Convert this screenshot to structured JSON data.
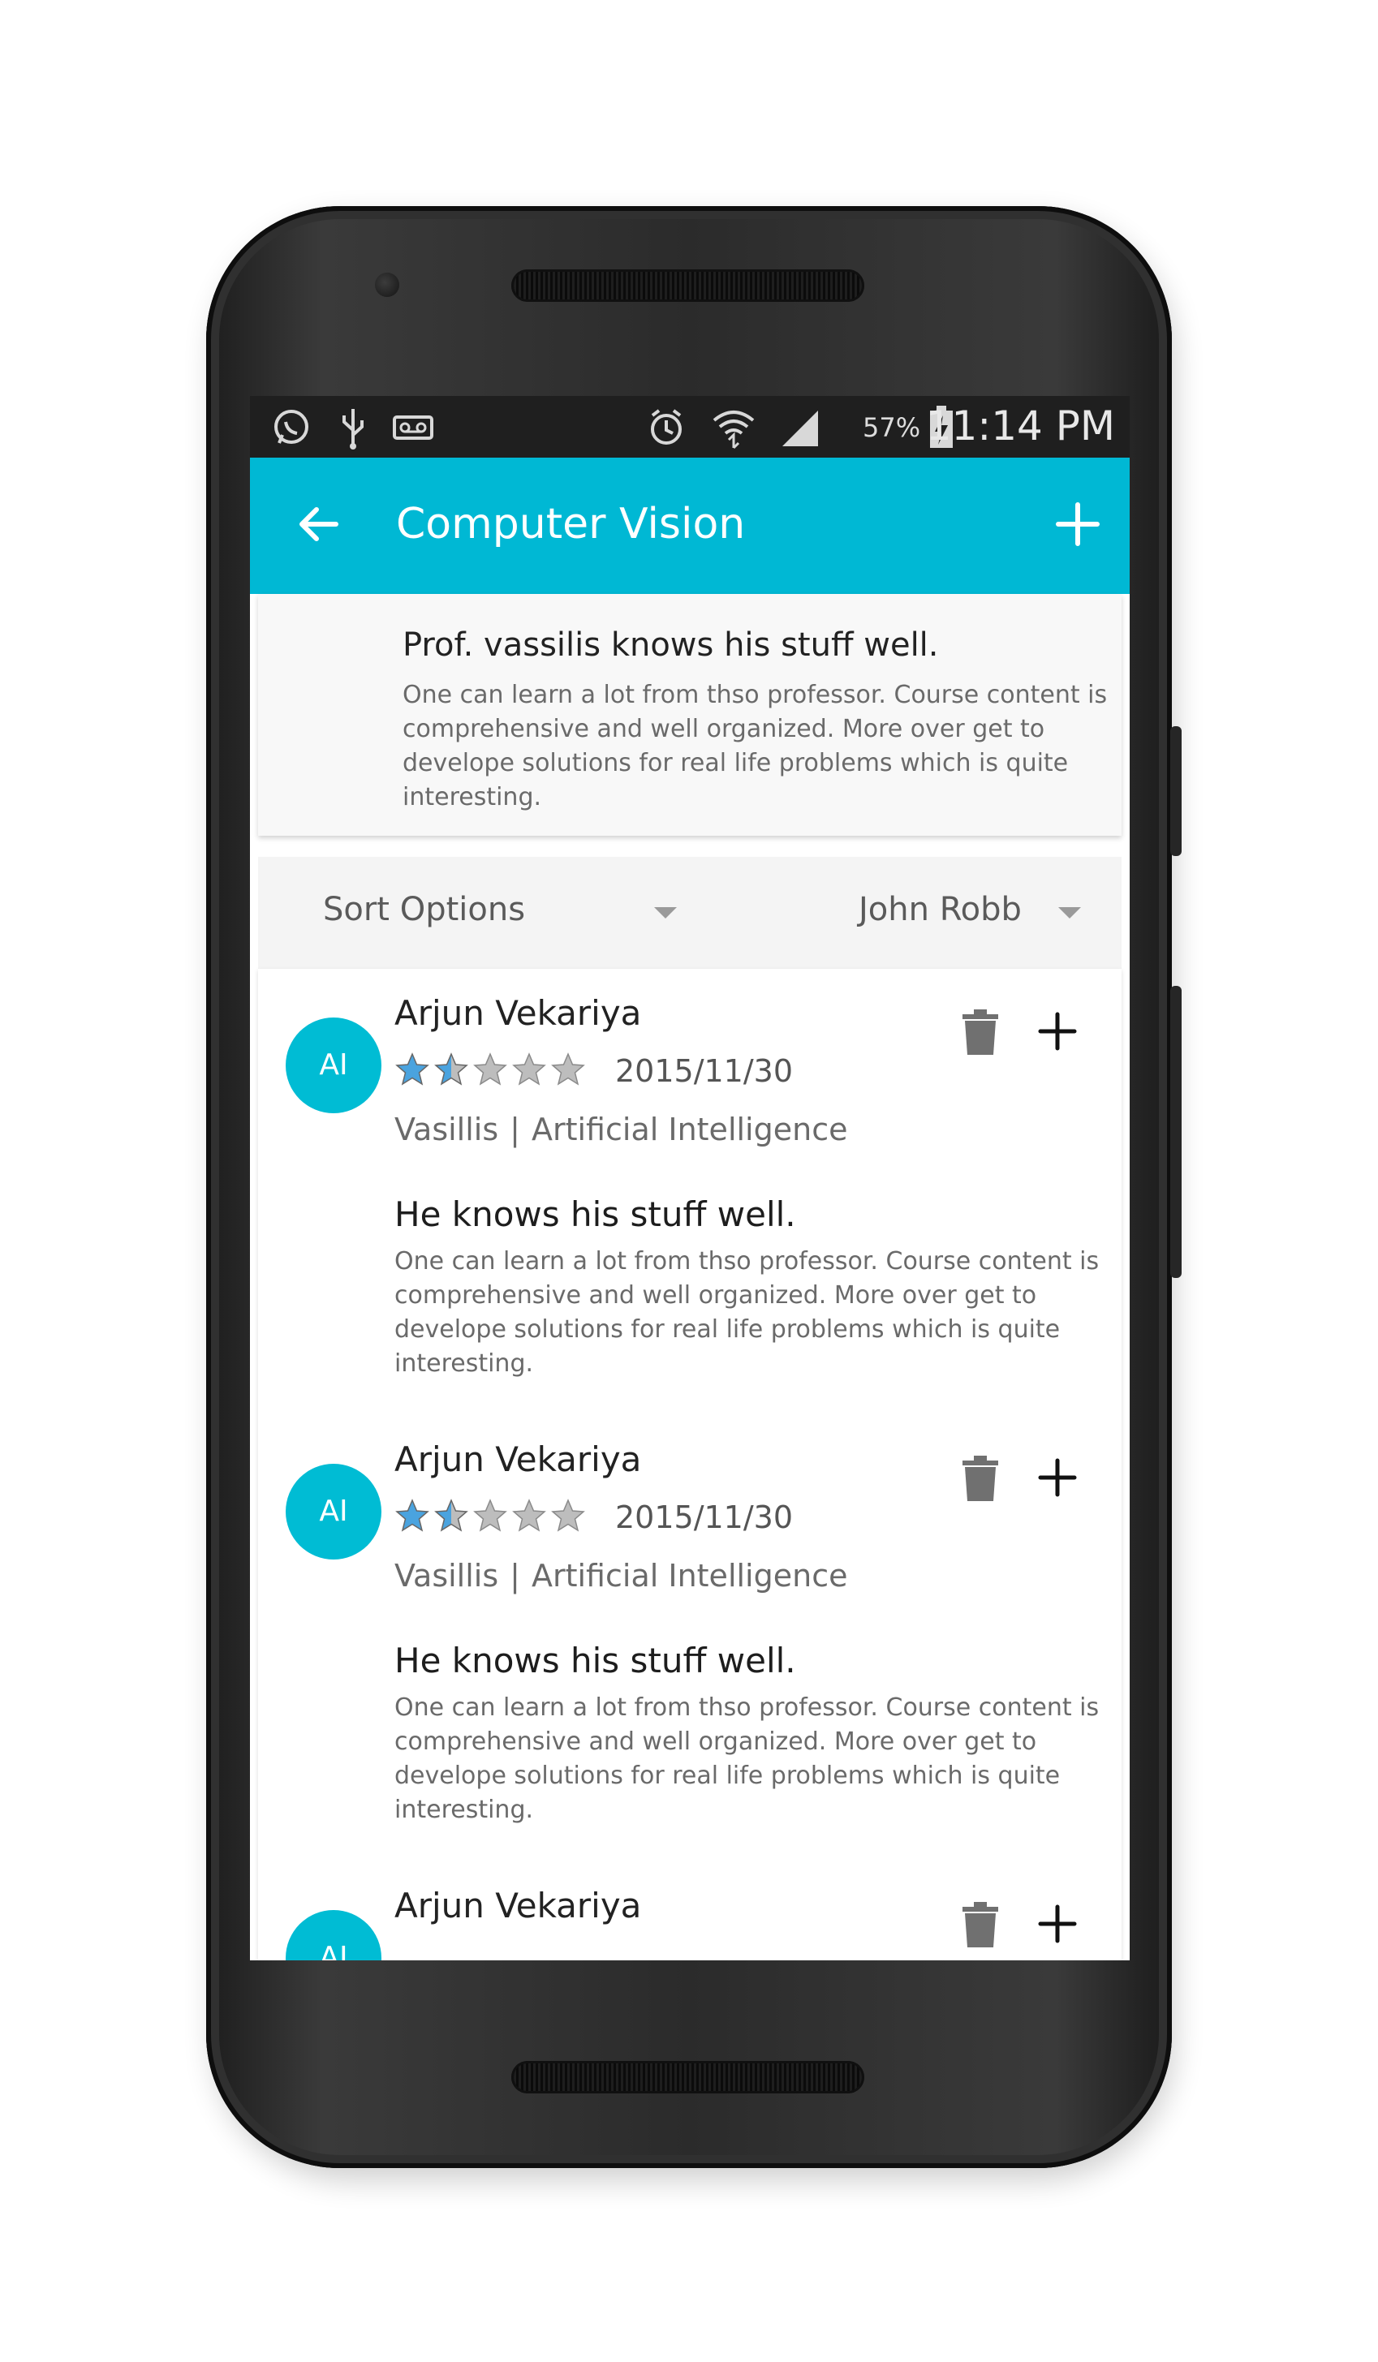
{
  "status_bar": {
    "battery": "57%",
    "time": "11:14 PM",
    "icons": [
      "whatsapp-icon",
      "usb-icon",
      "voicemail-icon",
      "alarm-icon",
      "wifi-icon",
      "signal-icon",
      "battery-charging-icon"
    ]
  },
  "app_bar": {
    "title": "Computer Vision",
    "back_icon": "arrow-left-icon",
    "add_icon": "plus-icon"
  },
  "summary": {
    "title": "Prof. vassilis knows his stuff well.",
    "body": "One can  learn a lot from thso professor. Course content is comprehensive and well organized. More over get to develope solutions for real life problems which is quite interesting."
  },
  "sort": {
    "sort_label": "Sort Options",
    "filter_label": "John Robb"
  },
  "reviews": [
    {
      "initials": "AI",
      "name": "Arjun Vekariya",
      "rating": 1.5,
      "rating_max": 5,
      "date": "2015/11/30",
      "professor": "Vasillis",
      "separator": "|",
      "course": "Artificial Intelligence",
      "title": "He knows his stuff well.",
      "body": "One can  learn a lot from thso professor. Course content is comprehensive and well organized. More over get to develope solutions for real life problems which is quite interesting."
    },
    {
      "initials": "AI",
      "name": "Arjun Vekariya",
      "rating": 1.5,
      "rating_max": 5,
      "date": "2015/11/30",
      "professor": "Vasillis",
      "separator": "|",
      "course": "Artificial Intelligence",
      "title": "He knows his stuff well.",
      "body": "One can  learn a lot from thso professor. Course content is comprehensive and well organized. More over get to develope solutions for real life problems which is quite interesting."
    },
    {
      "initials": "AI",
      "name": "Arjun Vekariya"
    }
  ],
  "colors": {
    "accent": "#00b8d4",
    "avatar": "#00bcd4",
    "star_filled": "#4aa3df",
    "star_empty": "#bdbdbd"
  }
}
